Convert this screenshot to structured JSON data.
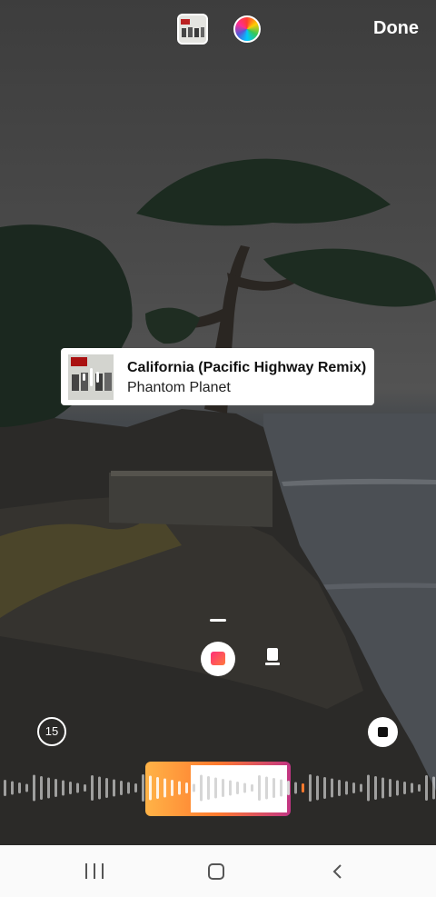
{
  "header": {
    "done_label": "Done",
    "color_picker_icon": "color-wheel-icon",
    "album_icon": "album-art-icon"
  },
  "music_sticker": {
    "title": "California (Pacific Highway Remix)",
    "artist": "Phantom Planet"
  },
  "controls": {
    "timer_label": "15",
    "mode_active": "video-sticker-icon",
    "mode_alt": "phone-card-icon",
    "stop_icon": "stop-icon"
  },
  "colors": {
    "accent_start": "#ff8a00",
    "accent_end": "#c13584",
    "card_bg": "#ffffff"
  },
  "navigation": {
    "recents": "recents-icon",
    "home": "home-icon",
    "back": "back-icon"
  }
}
